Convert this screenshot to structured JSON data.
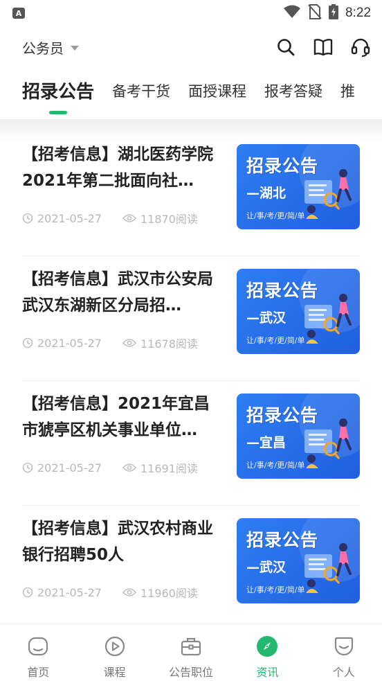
{
  "status_bar": {
    "time": "8:22",
    "app_badge": "A"
  },
  "header": {
    "category": "公务员",
    "icons": [
      "search-icon",
      "book-icon",
      "headset-icon"
    ]
  },
  "tabs": [
    {
      "label": "招录公告",
      "active": true
    },
    {
      "label": "备考干货",
      "active": false
    },
    {
      "label": "面授课程",
      "active": false
    },
    {
      "label": "报考答疑",
      "active": false
    },
    {
      "label": "推",
      "active": false
    }
  ],
  "articles": [
    {
      "title": "【招考信息】湖北医药学院2021年第二批面向社…",
      "date": "2021-05-27",
      "reads": "11870阅读",
      "thumb_title": "招录公告",
      "thumb_region": "—湖北",
      "thumb_slogan": "让/事/考/更/简/单"
    },
    {
      "title": "【招考信息】武汉市公安局武汉东湖新区分局招…",
      "date": "2021-05-27",
      "reads": "11678阅读",
      "thumb_title": "招录公告",
      "thumb_region": "—武汉",
      "thumb_slogan": "让/事/考/更/简/单"
    },
    {
      "title": "【招考信息】2021年宜昌市猇亭区机关事业单位…",
      "date": "2021-05-27",
      "reads": "11691阅读",
      "thumb_title": "招录公告",
      "thumb_region": "—宜昌",
      "thumb_slogan": "让/事/考/更/简/单"
    },
    {
      "title": "【招考信息】武汉农村商业银行招聘50人",
      "date": "2021-05-27",
      "reads": "11960阅读",
      "thumb_title": "招录公告",
      "thumb_region": "—武汉",
      "thumb_slogan": "让/事/考/更/简/单"
    }
  ],
  "bottom_nav": [
    {
      "label": "首页",
      "icon": "home-icon",
      "active": false
    },
    {
      "label": "课程",
      "icon": "play-icon",
      "active": false
    },
    {
      "label": "公告职位",
      "icon": "briefcase-icon",
      "active": false
    },
    {
      "label": "资讯",
      "icon": "compass-icon",
      "active": true
    },
    {
      "label": "个人",
      "icon": "smile-icon",
      "active": false
    }
  ],
  "colors": {
    "accent": "#22b86e",
    "thumb_blue": "#2f7ef2",
    "meta_gray": "#b8b8b8"
  }
}
